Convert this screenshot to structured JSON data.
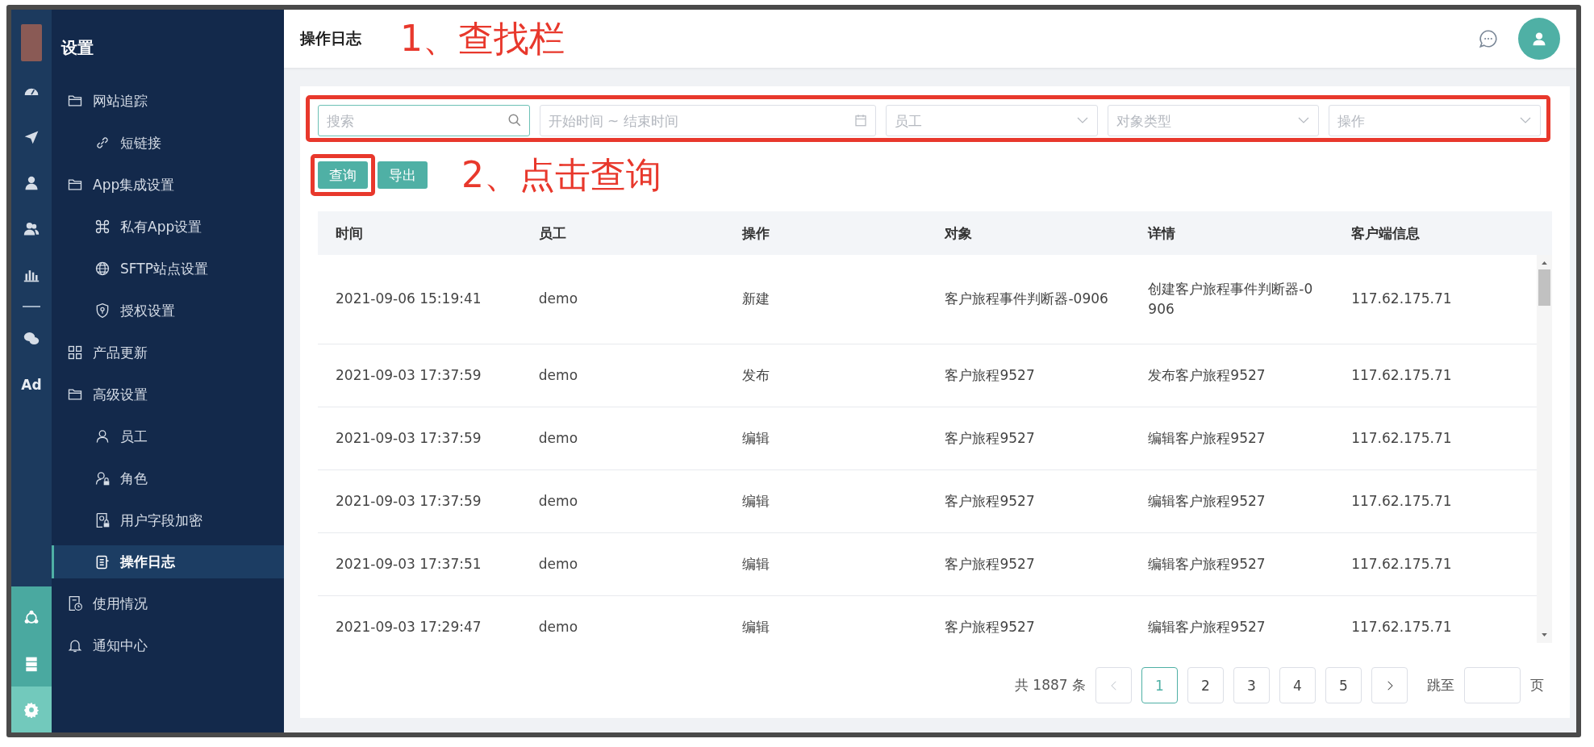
{
  "rail": {
    "top_items": [
      {
        "kind": "dashboard"
      },
      {
        "kind": "send"
      },
      {
        "kind": "user"
      },
      {
        "kind": "users"
      },
      {
        "kind": "chart"
      },
      {
        "kind": "divider"
      },
      {
        "kind": "wechat"
      },
      {
        "kind": "text",
        "label": "Ad"
      }
    ],
    "bottom_items": [
      {
        "kind": "network",
        "selected": false
      },
      {
        "kind": "server",
        "selected": false
      },
      {
        "kind": "gear",
        "selected": true
      }
    ]
  },
  "sidebar": {
    "title": "设置",
    "items": [
      {
        "kind": "folder",
        "label": "网站追踪",
        "selected": false,
        "children": [
          {
            "kind": "link",
            "label": "短链接",
            "selected": false
          }
        ]
      },
      {
        "kind": "folder",
        "label": "App集成设置",
        "selected": false,
        "children": [
          {
            "kind": "command",
            "label": "私有App设置",
            "selected": false
          },
          {
            "kind": "globe",
            "label": "SFTP站点设置",
            "selected": false
          },
          {
            "kind": "shield",
            "label": "授权设置",
            "selected": false
          }
        ]
      },
      {
        "kind": "grid",
        "label": "产品更新",
        "selected": false
      },
      {
        "kind": "folder",
        "label": "高级设置",
        "selected": false,
        "children": [
          {
            "kind": "user",
            "label": "员工",
            "selected": false
          },
          {
            "kind": "userlock",
            "label": "角色",
            "selected": false
          },
          {
            "kind": "doclock",
            "label": "用户字段加密",
            "selected": false
          },
          {
            "kind": "log",
            "label": "操作日志",
            "selected": true
          }
        ]
      },
      {
        "kind": "usage",
        "label": "使用情况",
        "selected": false
      },
      {
        "kind": "bell",
        "label": "通知中心",
        "selected": false
      }
    ]
  },
  "header": {
    "title": "操作日志",
    "note": "1、查找栏"
  },
  "filters": {
    "highlighted": true,
    "fields": [
      {
        "kind": "search",
        "placeholder": "搜索"
      },
      {
        "kind": "daterange",
        "placeholder": "开始时间 ~ 结束时间"
      },
      {
        "kind": "select",
        "placeholder": "员工"
      },
      {
        "kind": "select",
        "placeholder": "对象类型"
      },
      {
        "kind": "select",
        "placeholder": "操作"
      }
    ]
  },
  "actions": {
    "buttons": [
      {
        "label": "查询",
        "highlighted": true
      },
      {
        "label": "导出",
        "highlighted": false
      }
    ],
    "note": "2、点击查询"
  },
  "table": {
    "columns": [
      "时间",
      "员工",
      "操作",
      "对象",
      "详情",
      "客户端信息"
    ],
    "rows": [
      [
        "2021-09-06 15:19:41",
        "demo",
        "新建",
        "客户旅程事件判断器-0906",
        "创建客户旅程事件判断器-0906",
        "117.62.175.71"
      ],
      [
        "2021-09-03 17:37:59",
        "demo",
        "发布",
        "客户旅程9527",
        "发布客户旅程9527",
        "117.62.175.71"
      ],
      [
        "2021-09-03 17:37:59",
        "demo",
        "编辑",
        "客户旅程9527",
        "编辑客户旅程9527",
        "117.62.175.71"
      ],
      [
        "2021-09-03 17:37:59",
        "demo",
        "编辑",
        "客户旅程9527",
        "编辑客户旅程9527",
        "117.62.175.71"
      ],
      [
        "2021-09-03 17:37:51",
        "demo",
        "编辑",
        "客户旅程9527",
        "编辑客户旅程9527",
        "117.62.175.71"
      ],
      [
        "2021-09-03 17:29:47",
        "demo",
        "编辑",
        "客户旅程9527",
        "编辑客户旅程9527",
        "117.62.175.71"
      ]
    ]
  },
  "pagination": {
    "total": "共 1887 条",
    "prev_disabled": true,
    "next_disabled": false,
    "pages": [
      {
        "label": "1",
        "selected": true
      },
      {
        "label": "2",
        "selected": false
      },
      {
        "label": "3",
        "selected": false
      },
      {
        "label": "4",
        "selected": false
      },
      {
        "label": "5",
        "selected": false
      }
    ],
    "jump_label": "跳至",
    "jump_suffix": "页"
  }
}
